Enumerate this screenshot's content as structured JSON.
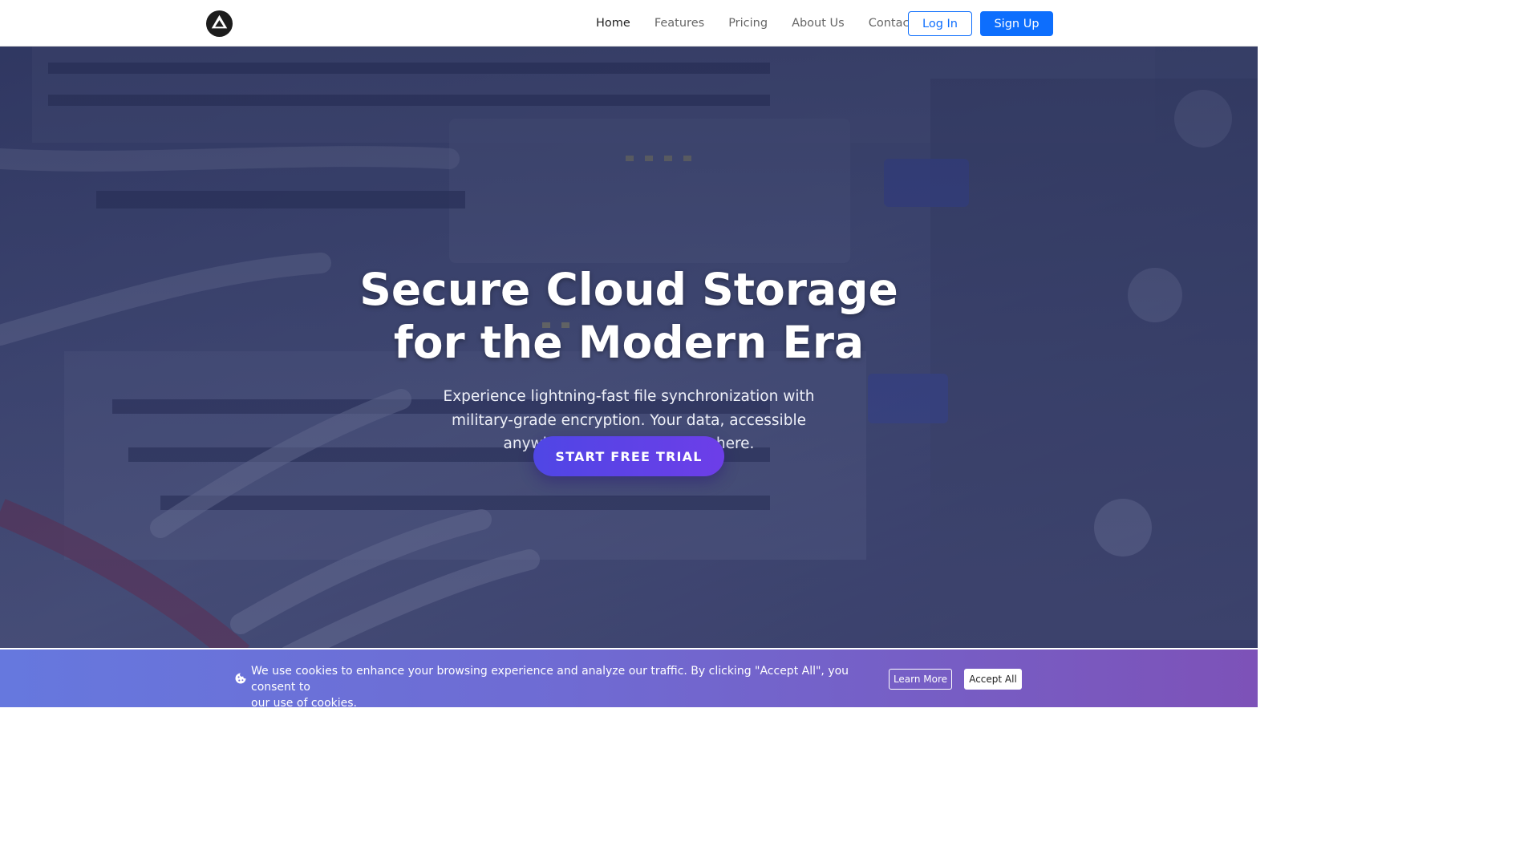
{
  "navbar": {
    "logo_icon": "diamond-logo-icon",
    "links": [
      {
        "label": "Home",
        "active": true
      },
      {
        "label": "Features",
        "active": false
      },
      {
        "label": "Pricing",
        "active": false
      },
      {
        "label": "About Us",
        "active": false
      },
      {
        "label": "Contact",
        "active": false
      }
    ],
    "login_label": "Log In",
    "signup_label": "Sign Up"
  },
  "hero": {
    "title_line1": "Secure Cloud Storage",
    "title_line2": "for the Modern Era",
    "subtitle_line1": "Experience lightning-fast file synchronization with",
    "subtitle_line2": "military-grade encryption. Your data, accessible",
    "subtitle_line3": "anywhere, protected everywhere.",
    "cta_label": "START FREE TRIAL",
    "background": "server-rack-network-switch-photo"
  },
  "cookie_banner": {
    "icon": "cookie-icon",
    "text_line1": "We use cookies to enhance your browsing experience and analyze our traffic. By clicking \"Accept All\", you consent to",
    "text_line2": "our use of cookies.",
    "learn_more_label": "Learn More",
    "accept_all_label": "Accept All"
  },
  "colors": {
    "primary": "#0d6efd",
    "cta_gradient_start": "#4f46e5",
    "cta_gradient_end": "#6d3ee8",
    "banner_gradient_start": "#6678de",
    "banner_gradient_end": "#7d52b8"
  }
}
